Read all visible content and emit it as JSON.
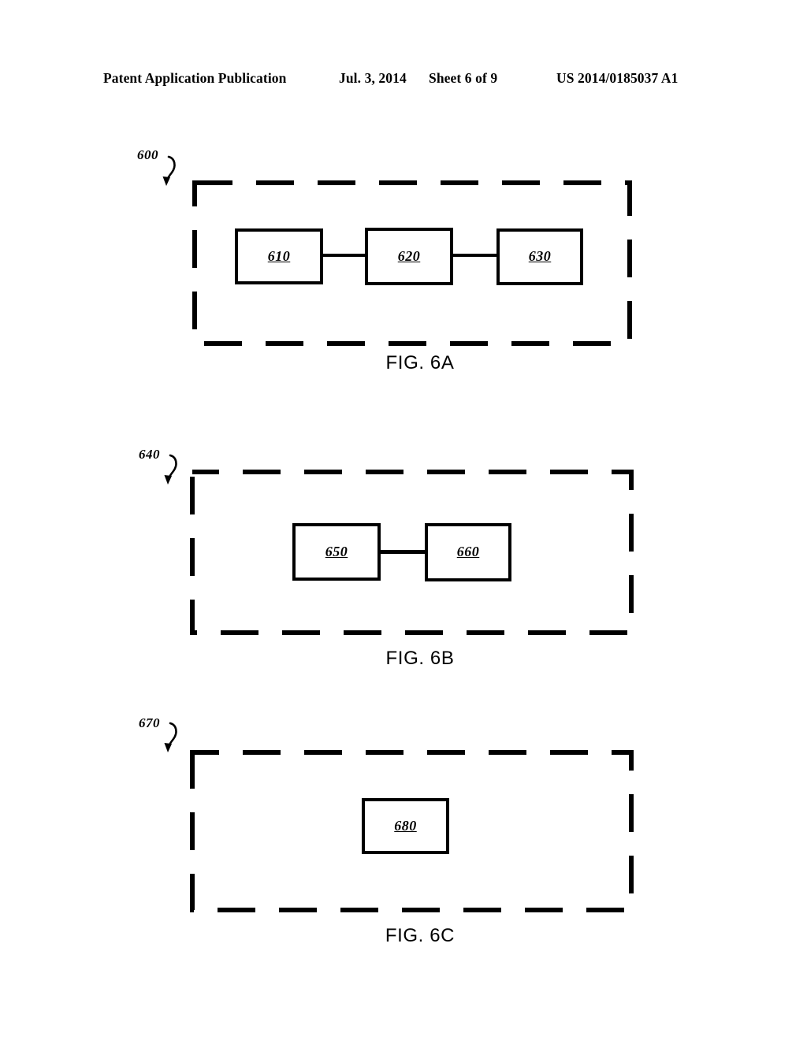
{
  "header": {
    "publication": "Patent Application Publication",
    "date": "Jul. 3, 2014",
    "sheet": "Sheet 6 of 9",
    "patent_number": "US 2014/0185037 A1"
  },
  "figures": [
    {
      "id": "fig-6a",
      "caption": "FIG. 6A",
      "enclosure_ref": "600",
      "boxes": [
        {
          "label": "610"
        },
        {
          "label": "620"
        },
        {
          "label": "630"
        }
      ]
    },
    {
      "id": "fig-6b",
      "caption": "FIG. 6B",
      "enclosure_ref": "640",
      "boxes": [
        {
          "label": "650"
        },
        {
          "label": "660"
        }
      ]
    },
    {
      "id": "fig-6c",
      "caption": "FIG. 6C",
      "enclosure_ref": "670",
      "boxes": [
        {
          "label": "680"
        }
      ]
    }
  ],
  "colors": {
    "ink": "#000000",
    "paper": "#ffffff"
  }
}
